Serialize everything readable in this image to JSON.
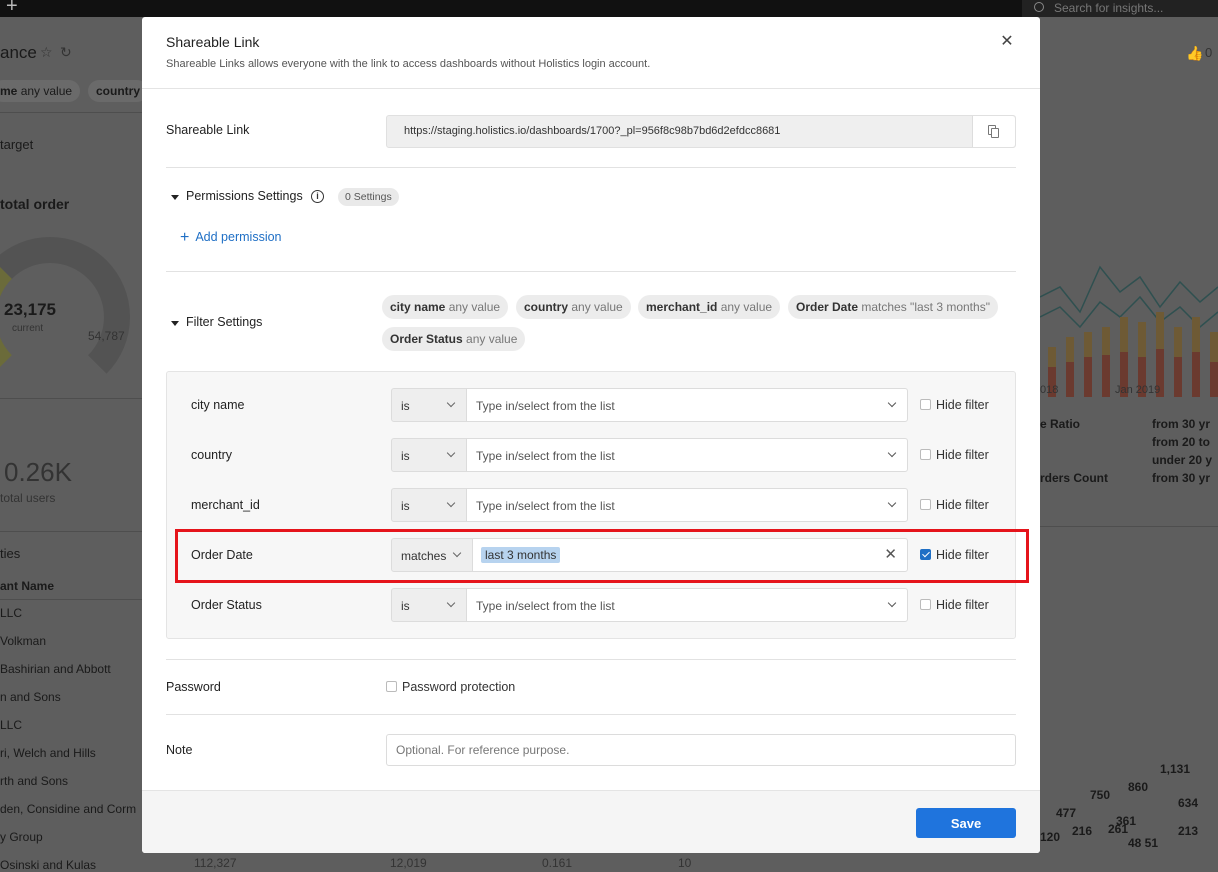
{
  "background": {
    "search_placeholder": "Search for insights...",
    "dashboard_title_fragment": "ance",
    "filter_chips": [
      {
        "name": "me",
        "value": "any value"
      },
      {
        "name": "country",
        "value": ""
      }
    ],
    "left_texts": {
      "target": "target",
      "total_order": "total order",
      "gauge_value": "23,175",
      "gauge_caption": "current",
      "gauge_max": "54,787",
      "users_value": "0.26K",
      "users_caption": "total users",
      "section": "ties",
      "col_header": "ant Name",
      "rows": [
        "LLC",
        "Volkman",
        "Bashirian and Abbott",
        "n and Sons",
        "LLC",
        "ri, Welch and Hills",
        "rth and Sons",
        "den, Considine and Corm",
        "y Group",
        "Osinski and Kulas"
      ]
    },
    "right_texts": {
      "x_ticks": [
        "018",
        "Jan 2019"
      ],
      "legend_title_1": "e Ratio",
      "legend_title_2": "rders Count",
      "legend_items": [
        "from 30 yr",
        "from 20 to",
        "under 20 y",
        "from 30 yr"
      ],
      "values": [
        "1,131",
        "750",
        "860",
        "634",
        "477",
        "361",
        "216",
        "261",
        "213",
        "120",
        "48 51"
      ]
    },
    "bottom_row": [
      "112,327",
      "12,019",
      "0.161",
      "10"
    ]
  },
  "modal": {
    "title": "Shareable Link",
    "subtitle": "Shareable Links allows everyone with the link to access dashboards without Holistics login account.",
    "link_label": "Shareable Link",
    "link_url": "https://staging.holistics.io/dashboards/1700?_pl=956f8c98b7bd6d2efdcc8681",
    "permissions": {
      "label": "Permissions Settings",
      "count_badge": "0 Settings",
      "add_label": "Add permission"
    },
    "filters": {
      "label": "Filter Settings",
      "chips": [
        {
          "name": "city name",
          "value": "any value"
        },
        {
          "name": "country",
          "value": "any value"
        },
        {
          "name": "merchant_id",
          "value": "any value"
        },
        {
          "name": "Order Date",
          "value": "matches \"last 3 months\""
        },
        {
          "name": "Order Status",
          "value": "any value"
        }
      ],
      "rows": [
        {
          "name": "city name",
          "operator": "is",
          "placeholder": "Type in/select from the list",
          "hide_label": "Hide filter",
          "hidden": false
        },
        {
          "name": "country",
          "operator": "is",
          "placeholder": "Type in/select from the list",
          "hide_label": "Hide filter",
          "hidden": false
        },
        {
          "name": "merchant_id",
          "operator": "is",
          "placeholder": "Type in/select from the list",
          "hide_label": "Hide filter",
          "hidden": false
        },
        {
          "name": "Order Date",
          "operator": "matches",
          "value": "last 3 months",
          "hide_label": "Hide filter",
          "hidden": true
        },
        {
          "name": "Order Status",
          "operator": "is",
          "placeholder": "Type in/select from the list",
          "hide_label": "Hide filter",
          "hidden": false
        }
      ]
    },
    "password": {
      "label": "Password",
      "checkbox_label": "Password protection",
      "checked": false
    },
    "note": {
      "label": "Note",
      "placeholder": "Optional. For reference purpose.",
      "value": ""
    },
    "save_label": "Save"
  },
  "colors": {
    "accent": "#1f74dd",
    "link": "#1f6fc5",
    "highlight_box": "#e5141b",
    "selection": "#b7d3ef",
    "overlay": "#5c5c5c"
  }
}
